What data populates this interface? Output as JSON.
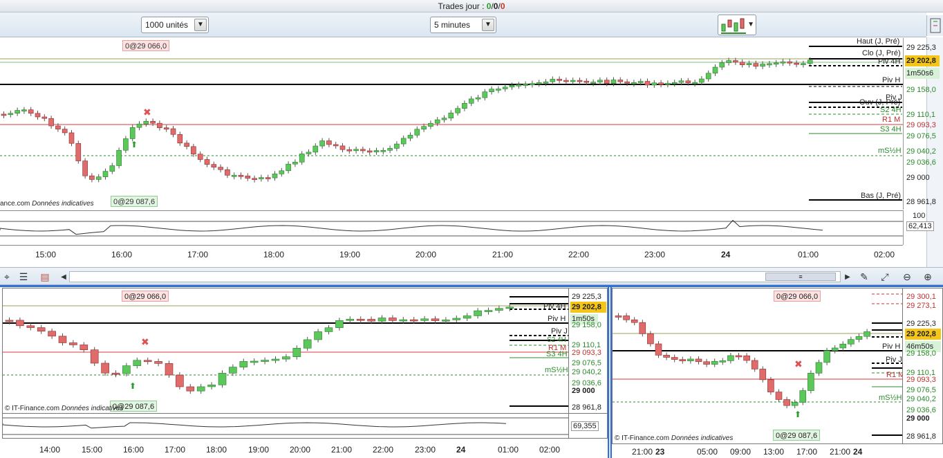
{
  "header": {
    "title_prefix": "Trades jour : ",
    "t1": "0",
    "slash": "/",
    "t2": "0",
    "t3": "0"
  },
  "toolbar": {
    "units": "1000 unités",
    "period": "5 minutes"
  },
  "main": {
    "badge_top": "0@29 066,0",
    "badge_bottom": "0@29 087,6",
    "source": "ance.com",
    "note": "Données indicatives",
    "levels": [
      {
        "label": "Haut (J, Pré)",
        "price": "29 225,3"
      },
      {
        "label": "Clo (J, Pré)",
        "price": "29 202,8"
      },
      {
        "label": "Piv 4H",
        "price": "1m50s"
      },
      {
        "label": "Piv H",
        "price": "29 158,0"
      },
      {
        "label": "Piv J",
        "price": ""
      },
      {
        "label": "Ouv (J, Pré)",
        "price": ""
      },
      {
        "label": "S2 4H",
        "price": "29 110,1"
      },
      {
        "label": "R1 M",
        "price": "29 093,3"
      },
      {
        "label": "S3 4H",
        "price": "29 076,5"
      },
      {
        "label": "mS½H",
        "price": "29 040,2"
      }
    ],
    "extra_prices": [
      "29 036,6",
      "29 000",
      "28 961,8"
    ],
    "low_label": "Bas (J, Pré)",
    "osc_top": "100",
    "osc_value": "62,413",
    "current_price": "29 202,8",
    "timer": "1m50s",
    "timer_suffix": "6",
    "xticks": [
      "15:00",
      "16:00",
      "17:00",
      "18:00",
      "19:00",
      "20:00",
      "21:00",
      "22:00",
      "23:00",
      "24",
      "01:00",
      "02:00"
    ]
  },
  "left": {
    "badge_top": "0@29 066,0",
    "badge_bottom": "0@29 087,6",
    "source": "© IT-Finance.com",
    "note": "Données indicatives",
    "current_price": "29 202,8",
    "timer": "1m50s",
    "prices": [
      "29 225,3",
      "29 158,0",
      "29 110,1",
      "29 093,3",
      "29 076,5",
      "29 040,2",
      "29 036,6",
      "29 000",
      "28 961,8"
    ],
    "level_labels": [
      "Piv 4H",
      "Piv H",
      "Piv J",
      "S2 4H",
      "R1 M",
      "S3 4H",
      "mS½H"
    ],
    "osc_value": "69,355",
    "xticks": [
      "14:00",
      "15:00",
      "16:00",
      "17:00",
      "18:00",
      "19:00",
      "20:00",
      "21:00",
      "22:00",
      "23:00",
      "24",
      "01:00",
      "02:00"
    ]
  },
  "right": {
    "badge_top": "0@29 066,0",
    "badge_bottom": "0@29 087,6",
    "source": "© IT-Finance.com",
    "note": "Données indicatives",
    "current_price": "29 202,8",
    "timer": "46m50s",
    "prices": [
      "29 300,1",
      "29 273,1",
      "29 225,3",
      "29 158,0",
      "29 110,1",
      "29 093,3",
      "29 076,5",
      "29 040,2",
      "29 036,6",
      "29 000",
      "28 961,8"
    ],
    "level_labels": [
      "Piv H",
      "Piv J",
      "R1 M",
      "mS½H"
    ],
    "xticks": [
      "21:00",
      "23",
      "05:00",
      "09:00",
      "13:00",
      "17:00",
      "21:00",
      "24"
    ]
  },
  "colors": {
    "up": "#5cc85c",
    "down": "#e06b6b",
    "pivot": "#000000",
    "r1": "#d83a3a",
    "s": "#2b8a2b",
    "accent": "#2f6fd8",
    "price_bg": "#f5c518"
  }
}
